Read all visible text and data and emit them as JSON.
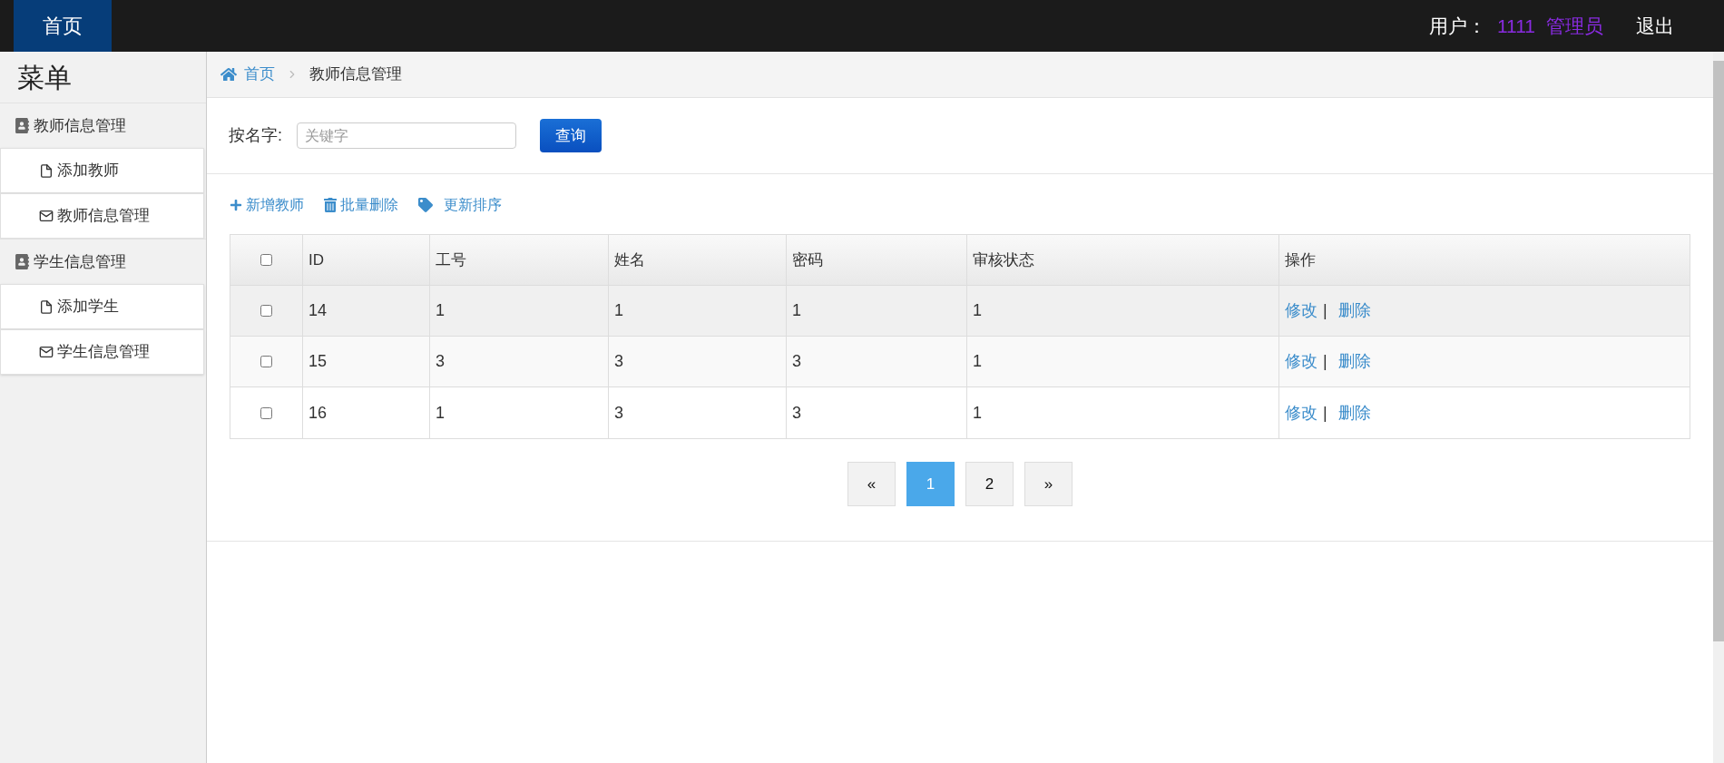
{
  "topbar": {
    "home": "首页",
    "user_label": "用户：",
    "user_id": "1111",
    "role": "管理员",
    "logout": "退出"
  },
  "sidebar": {
    "title": "菜单",
    "groups": [
      {
        "label": "教师信息管理",
        "children": [
          {
            "label": "添加教师",
            "kind": "file"
          },
          {
            "label": "教师信息管理",
            "kind": "mail"
          }
        ]
      },
      {
        "label": "学生信息管理",
        "children": [
          {
            "label": "添加学生",
            "kind": "file"
          },
          {
            "label": "学生信息管理",
            "kind": "mail"
          }
        ]
      }
    ]
  },
  "breadcrumb": {
    "home": "首页",
    "current": "教师信息管理"
  },
  "search": {
    "label": "按名字:",
    "placeholder": "关键字",
    "button": "查询"
  },
  "toolbar": [
    {
      "label": "新增教师",
      "kind": "plus"
    },
    {
      "label": "批量删除",
      "kind": "trash"
    },
    {
      "label": "更新排序",
      "kind": "tag"
    }
  ],
  "table": {
    "columns": [
      "ID",
      "工号",
      "姓名",
      "密码",
      "审核状态",
      "操作"
    ],
    "header_checked": false,
    "rows": [
      {
        "checked": false,
        "cells": [
          "14",
          "1",
          "1",
          "1",
          "1"
        ],
        "actions": [
          "修改",
          "删除"
        ],
        "separator": "|"
      },
      {
        "checked": false,
        "cells": [
          "15",
          "3",
          "3",
          "3",
          "1"
        ],
        "actions": [
          "修改",
          "删除"
        ],
        "separator": "|"
      },
      {
        "checked": false,
        "cells": [
          "16",
          "1",
          "3",
          "3",
          "1"
        ],
        "actions": [
          "修改",
          "删除"
        ],
        "separator": "|"
      }
    ]
  },
  "pagination": [
    {
      "label": "«",
      "selected": false
    },
    {
      "label": "1",
      "selected": true
    },
    {
      "label": "2",
      "selected": false
    },
    {
      "label": "»",
      "selected": false
    }
  ]
}
